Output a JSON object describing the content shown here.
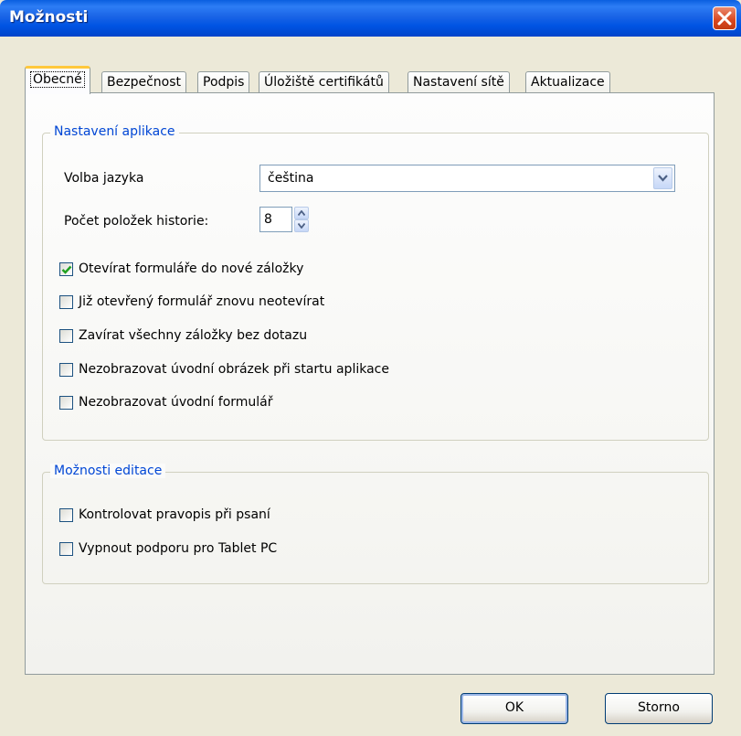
{
  "window": {
    "title": "Možnosti"
  },
  "tabs": [
    {
      "label": "Obecné",
      "active": true
    },
    {
      "label": "Bezpečnost"
    },
    {
      "label": "Podpis"
    },
    {
      "label": "Úložiště certifikátů"
    },
    {
      "label": "Nastavení sítě"
    },
    {
      "label": "Aktualizace"
    }
  ],
  "app_settings": {
    "title": "Nastavení aplikace",
    "language_label": "Volba jazyka",
    "language_value": "čeština",
    "history_label": "Počet položek historie:",
    "history_value": "8",
    "checkboxes": [
      {
        "label": "Otevírat formuláře do nové záložky",
        "checked": true
      },
      {
        "label": "Již otevřený formulář znovu neotevírat",
        "checked": false
      },
      {
        "label": "Zavírat všechny záložky bez dotazu",
        "checked": false
      },
      {
        "label": "Nezobrazovat úvodní obrázek při startu aplikace",
        "checked": false
      },
      {
        "label": "Nezobrazovat úvodní formulář",
        "checked": false
      }
    ]
  },
  "edit_options": {
    "title": "Možnosti editace",
    "checkboxes": [
      {
        "label": "Kontrolovat pravopis při psaní",
        "checked": false
      },
      {
        "label": "Vypnout podporu pro Tablet PC",
        "checked": false
      }
    ]
  },
  "buttons": {
    "ok": "OK",
    "cancel": "Storno"
  },
  "colors": {
    "accent": "#0046d5",
    "titlebar": "#0054e3",
    "close": "#d8461e",
    "tab_highlight": "#ffc83c"
  }
}
